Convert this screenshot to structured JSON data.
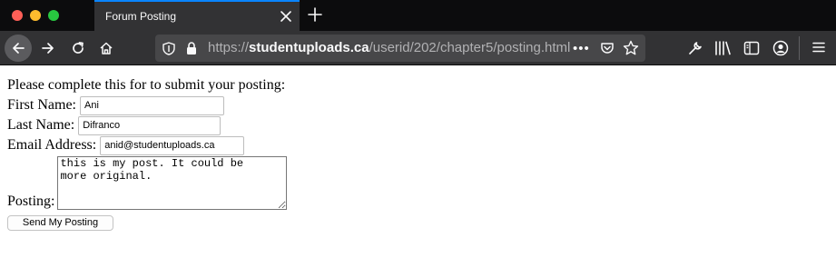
{
  "browser": {
    "tab_title": "Forum Posting",
    "url": {
      "prefix": "https://",
      "host": "studentuploads.ca",
      "path": "/userid/202/chapter5/posting.html"
    },
    "more_label": "•••"
  },
  "form": {
    "intro": "Please complete this for to submit your posting:",
    "first_name_label": "First Name:",
    "first_name_value": "Ani",
    "last_name_label": "Last Name:",
    "last_name_value": "Difranco",
    "email_label": "Email Address:",
    "email_value": "anid@studentuploads.ca",
    "posting_label": "Posting:",
    "posting_value": "this is my post. It could be\nmore original.",
    "submit_label": "Send My Posting"
  },
  "icons": {
    "close_tab": "close-icon",
    "new_tab": "plus-icon",
    "back": "arrow-left-icon",
    "forward": "arrow-right-icon",
    "reload": "reload-icon",
    "home": "home-icon",
    "tracking": "shield-icon",
    "lock": "lock-icon",
    "pocket": "pocket-icon",
    "bookmark": "star-icon",
    "tools": "wrench-icon",
    "library": "library-icon",
    "sidebar": "sidebar-icon",
    "account": "account-icon",
    "menu": "hamburger-icon"
  },
  "colors": {
    "accent": "#0a84ff",
    "chrome_dark": "#0c0c0d",
    "chrome": "#323234",
    "urlbar": "#474749"
  }
}
